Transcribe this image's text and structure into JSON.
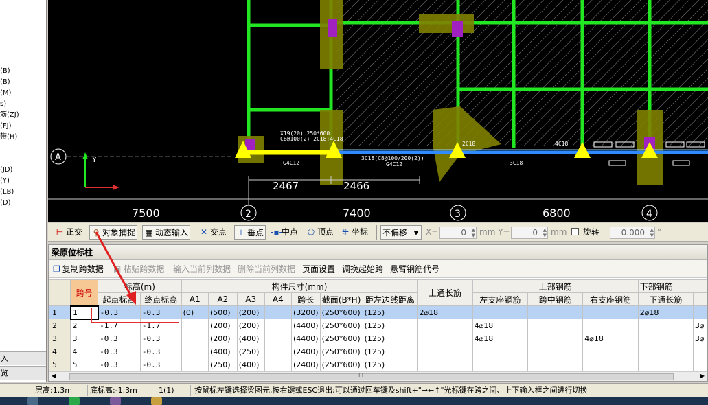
{
  "left_panel": {
    "items": [
      "(B)",
      "(B)",
      "(M)",
      "s)",
      "筋(ZJ)",
      "(FJ)",
      "带(H)",
      "(JD)",
      "(Y)",
      "(LB)",
      "(D)"
    ],
    "bottom_items": [
      "入",
      "览"
    ]
  },
  "cad": {
    "axis_label_A": "A",
    "axis_y": "Y",
    "grid_labels": [
      "2",
      "3",
      "4"
    ],
    "spans": [
      "7500",
      "7400",
      "6800"
    ],
    "dims": [
      "2467",
      "2466"
    ],
    "annotations": [
      "X19(20) 250*600",
      "C8@100(2) 2C18;4C18",
      "G4C12",
      "3C18(C8@100/200(2))",
      "G4C12",
      "3C18",
      "4C18",
      "2C18"
    ]
  },
  "snap_toolbar": {
    "ortho": "正交",
    "object_snap": "对象捕捉",
    "dynamic_input": "动态输入",
    "intersection": "交点",
    "perpendicular": "垂点",
    "midpoint": "中点",
    "vertex": "顶点",
    "coordinate": "坐标",
    "offset_mode": "不偏移",
    "x_label": "X=",
    "x_value": "0",
    "y_label": "mm Y=",
    "y_value": "0",
    "y_unit": "mm",
    "rotate": "旋转",
    "rotate_value": "0.000",
    "deg": "°"
  },
  "panel": {
    "title": "梁原位标柱",
    "toolbar": [
      "复制跨数据",
      "粘贴跨数据",
      "输入当前列数据",
      "删除当前列数据",
      "页面设置",
      "调换起始跨",
      "悬臂钢筋代号"
    ],
    "toolbar_disabled": [
      false,
      true,
      true,
      true,
      false,
      false,
      false
    ],
    "headers_top": {
      "span_no": "跨号",
      "elevation": "标高(m)",
      "size": "构件尺寸(mm)",
      "top_through": "上通长筋",
      "top_rebar": "上部钢筋",
      "bottom_rebar": "下部钢筋"
    },
    "headers_sub": [
      "起点标高",
      "终点标高",
      "A1",
      "A2",
      "A3",
      "A4",
      "跨长",
      "截面(B*H)",
      "距左边线距离",
      "左支座钢筋",
      "跨中钢筋",
      "右支座钢筋",
      "下通长筋"
    ],
    "rows": [
      {
        "n": "1",
        "span": "1",
        "s_el": "-0.3",
        "e_el": "-0.3",
        "a1": "(0)",
        "a2": "(500)",
        "a3": "(200)",
        "a4": "",
        "len": "(3200)",
        "sec": "(250*600)",
        "dist": "(125)",
        "top": "2⌀18",
        "left": "",
        "mid": "",
        "right": "",
        "bot": "2⌀18",
        "extra": ""
      },
      {
        "n": "2",
        "span": "2",
        "s_el": "-1.7",
        "e_el": "-1.7",
        "a1": "",
        "a2": "(200)",
        "a3": "(200)",
        "a4": "",
        "len": "(4400)",
        "sec": "(250*600)",
        "dist": "(125)",
        "top": "",
        "left": "4⌀18",
        "mid": "",
        "right": "",
        "bot": "",
        "extra": "3⌀"
      },
      {
        "n": "3",
        "span": "3",
        "s_el": "-0.3",
        "e_el": "-0.3",
        "a1": "",
        "a2": "(200)",
        "a3": "(400)",
        "a4": "",
        "len": "(4400)",
        "sec": "(250*600)",
        "dist": "(125)",
        "top": "",
        "left": "4⌀18",
        "mid": "",
        "right": "4⌀18",
        "bot": "",
        "extra": "3⌀"
      },
      {
        "n": "4",
        "span": "4",
        "s_el": "-0.3",
        "e_el": "-0.3",
        "a1": "",
        "a2": "(400)",
        "a3": "(250)",
        "a4": "",
        "len": "(2400)",
        "sec": "(250*600)",
        "dist": "(125)",
        "top": "",
        "left": "",
        "mid": "",
        "right": "",
        "bot": "",
        "extra": ""
      },
      {
        "n": "5",
        "span": "5",
        "s_el": "-0.3",
        "e_el": "-0.3",
        "a1": "",
        "a2": "(250)",
        "a3": "(400)",
        "a4": "",
        "len": "(2400)",
        "sec": "(250*600)",
        "dist": "(125)",
        "top": "",
        "left": "",
        "mid": "",
        "right": "",
        "bot": "",
        "extra": ""
      }
    ],
    "scroll_mark": "III"
  },
  "status": {
    "floor_height": "层高:1.3m",
    "bottom_elev": "底标高:-1.3m",
    "count": "1(1)",
    "hint": "按鼠标左键选择梁图元,按右键或ESC退出;可以通过回车键及shift+\"→←↑\"光标键在跨之间、上下输入框之间进行切换"
  },
  "colors": {
    "cad_bg": "#000000",
    "beam_green": "#22e622",
    "column_olive": "#808000",
    "selected_beam": "#ffff00",
    "blue_beam": "#2f8bff",
    "header_highlight": "#f6c893",
    "selected_row": "#b7d2f2",
    "annotation_red": "#e03030"
  }
}
